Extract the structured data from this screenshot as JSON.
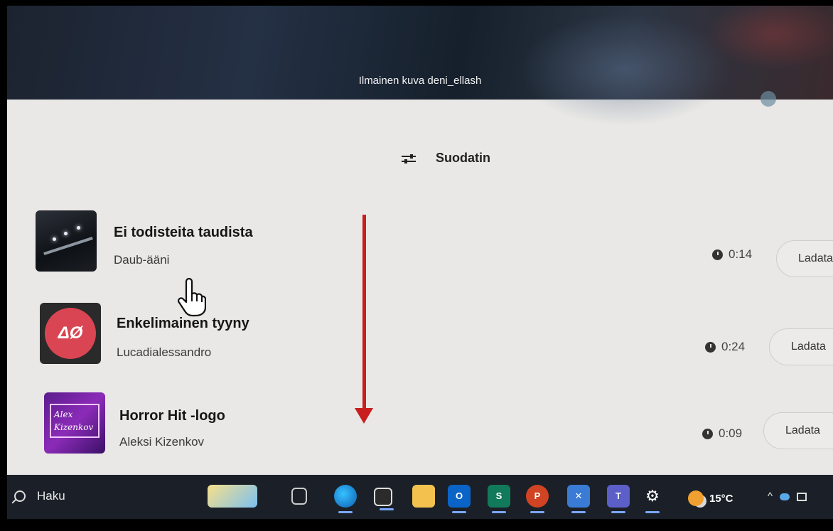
{
  "banner": {
    "caption": "Ilmainen kuva deni_ellash"
  },
  "filter": {
    "label": "Suodatin",
    "icon": "sliders-icon"
  },
  "tracks": [
    {
      "title": "Ei todisteita taudista",
      "artist": "Daub-ääni",
      "duration": "0:14",
      "action": "Ladata"
    },
    {
      "title": "Enkelimainen tyyny",
      "artist": "Lucadialessandro",
      "duration": "0:24",
      "action": "Ladata"
    },
    {
      "title": "Horror Hit -logo",
      "artist": "Aleksi Kizenkov",
      "duration": "0:09",
      "action": "Ladata"
    }
  ],
  "thumbs": {
    "t2_text": "ΔØ",
    "t3_line1": "Alex",
    "t3_line2": "Kizenkov"
  },
  "taskbar": {
    "search_label": "Haku",
    "apps": [
      "notes-icon",
      "task-view-icon",
      "edge-icon",
      "store-icon",
      "file-explorer-icon",
      "outlook-icon",
      "sway-icon",
      "powerpoint-icon",
      "snip-icon",
      "teams-icon",
      "settings-icon"
    ],
    "weather": "15°C",
    "tray_chevron": "^"
  },
  "colors": {
    "arrow": "#c81e1e",
    "taskbar": "#1b2028"
  }
}
